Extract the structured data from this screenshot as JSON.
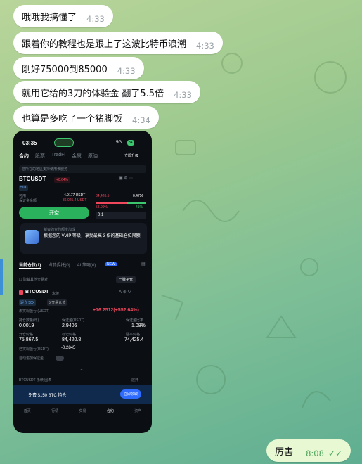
{
  "messages": [
    {
      "text": "哦哦我搞懂了",
      "time": "4:33"
    },
    {
      "text": "跟着你的教程也是跟上了这波比特币浪潮",
      "time": "4:33"
    },
    {
      "text": "刚好75000到85000",
      "time": "4:33"
    },
    {
      "text": "就用它给的3刀的体验金 翻了5.5倍",
      "time": "4:33"
    },
    {
      "text": "也算是多吃了一个猪脚饭",
      "time": "4:34"
    }
  ],
  "outgoing": {
    "text": "厉害",
    "time": "8:08",
    "ticks": "✓✓"
  },
  "phone": {
    "status": {
      "time": "03:35",
      "net": "5G",
      "battery": "84"
    },
    "tabs": [
      "合约",
      "股票",
      "TradFi",
      "金属",
      "原油"
    ],
    "tab_more": "立即升级",
    "notice": "您所在的地区支持使用该服务",
    "pair": "BTCUSDT",
    "change": "+0.64%",
    "leverage": "50X",
    "bal_label": "可用",
    "bal_value": "4.9177 USDT",
    "avg_label": "保证金余额",
    "avg_value": "86,025.4 USDT",
    "ob_price1": "84,420.5",
    "ob_price2": "0.4756",
    "ob_pct1": "58.99%",
    "ob_pct2": "41%",
    "qty": "0.1",
    "open_btn": "开空",
    "promo_title": "新会的合约额度加成",
    "promo_text": "根据您的 VVIP 等级，享受最高 3 倍的基础仓位限额",
    "sub_tabs": [
      "当前仓位(1)",
      "当前委托(0)",
      "AI 策略(0)"
    ],
    "new_badge": "NEW",
    "hide_label": "隐藏其他交易对",
    "close_all": "一键平仓",
    "pos_pair": "BTCUSDT",
    "pos_type": "永续",
    "pos_mode": "逐仓 50X",
    "pos_tag": "5 交易仓位",
    "pnl_label": "未实现盈亏 (USDT)",
    "pnl_value": "+16.2512(+552.64%)",
    "col1": [
      "持仓数量(币)",
      "0.0019"
    ],
    "col2": [
      "保证金(USDT)",
      "2.9406"
    ],
    "col3": [
      "保证金比率",
      "1.08%"
    ],
    "col4": [
      "开仓价格",
      "75,867.5"
    ],
    "col5": [
      "标记价格",
      "84,420.8"
    ],
    "col6": [
      "强平价格",
      "74,425.4"
    ],
    "realized": "已实现盈亏(USDT)",
    "realized_value": "-0.2845",
    "auto_margin": "自动追加保证金",
    "chart_bar": "BTCUSDT 永续 图表",
    "chart_expand": "展开",
    "banner": "免费 $150 BTC 持仓",
    "banner_btn": "立即领取",
    "nav": [
      "首页",
      "行情",
      "交易",
      "合约",
      "资产"
    ]
  }
}
